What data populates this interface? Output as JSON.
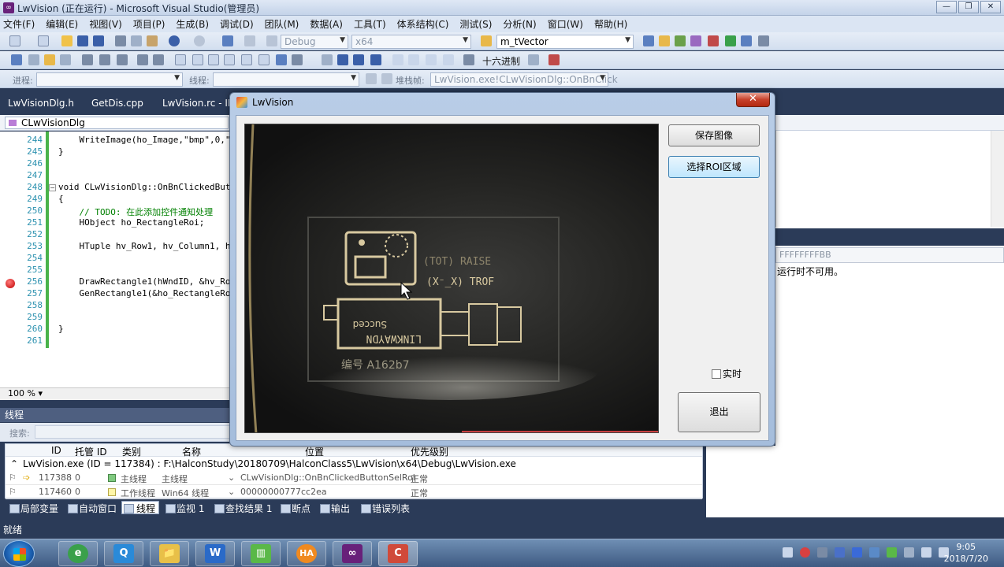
{
  "vs": {
    "title": "LwVision (正在运行) - Microsoft Visual Studio(管理员)",
    "window_controls": [
      "—",
      "❐",
      "✕"
    ],
    "menu": [
      "文件(F)",
      "编辑(E)",
      "视图(V)",
      "项目(P)",
      "生成(B)",
      "调试(D)",
      "团队(M)",
      "数据(A)",
      "工具(T)",
      "体系结构(C)",
      "测试(S)",
      "分析(N)",
      "窗口(W)",
      "帮助(H)"
    ],
    "toolbar": {
      "config": "Debug",
      "platform": "x64",
      "find": "m_tVector",
      "hex_label": "十六进制",
      "process_label": "进程:",
      "thread_label": "线程:",
      "stackframe_label": "堆栈帧:",
      "stackframe_value": "LwVision.exe!CLwVisionDlg::OnBnClick"
    },
    "doc_tabs": [
      "LwVisionDlg.h",
      "GetDis.cpp",
      "LwVision.rc - ID"
    ],
    "nav_class": "CLwVisionDlg",
    "editor": {
      "lines": [
        {
          "n": "244",
          "code": "    WriteImage(ho_Image,\"bmp\",0,\""
        },
        {
          "n": "245",
          "code": "}"
        },
        {
          "n": "246",
          "code": ""
        },
        {
          "n": "247",
          "code": ""
        },
        {
          "n": "248",
          "code": "void CLwVisionDlg::OnBnClickedBut"
        },
        {
          "n": "249",
          "code": "{"
        },
        {
          "n": "250",
          "code": "    // TODO: 在此添加控件通知处理"
        },
        {
          "n": "251",
          "code": "    HObject ho_RectangleRoi;"
        },
        {
          "n": "252",
          "code": ""
        },
        {
          "n": "253",
          "code": "    HTuple hv_Row1, hv_Column1, h"
        },
        {
          "n": "254",
          "code": ""
        },
        {
          "n": "255",
          "code": ""
        },
        {
          "n": "256",
          "code": "    DrawRectangle1(hWndID, &hv_Ro"
        },
        {
          "n": "257",
          "code": "    GenRectangle1(&ho_RectangleRo"
        },
        {
          "n": "258",
          "code": ""
        },
        {
          "n": "259",
          "code": ""
        },
        {
          "n": "260",
          "code": "}"
        },
        {
          "n": "261",
          "code": ""
        }
      ],
      "zoom": "100 %"
    },
    "properties": {
      "combo": "FFFFFFFFBB",
      "message": "运行时不可用。"
    },
    "threads": {
      "title": "线程",
      "search_label": "搜索:",
      "columns": [
        "ID",
        "托管 ID",
        "类别",
        "名称",
        "位置",
        "优先级别"
      ],
      "process": "LwVision.exe (ID = 117384) : F:\\HalconStudy\\20180709\\HalconClass5\\LwVision\\x64\\Debug\\LwVision.exe",
      "rows": [
        {
          "id": "117388",
          "mid": "0",
          "cat": "主线程",
          "name": "主线程",
          "loc": "CLwVisionDlg::OnBnClickedButtonSelRoi",
          "pri": "正常"
        },
        {
          "id": "117460",
          "mid": "0",
          "cat": "工作线程",
          "name": "Win64 线程",
          "loc": "00000000777cc2ea",
          "pri": "正常"
        }
      ]
    },
    "bottom_tabs": [
      "局部变量",
      "自动窗口",
      "线程",
      "监视 1",
      "查找结果 1",
      "断点",
      "输出",
      "错误列表"
    ],
    "status": "就绪"
  },
  "dialog": {
    "title": "LwVision",
    "close": "✕",
    "btn_save": "保存图像",
    "btn_roi": "选择ROI区域",
    "chk_realtime": "实时",
    "btn_exit": "退出",
    "camera_text": {
      "port": "(X⁻_X) TROF",
      "raise": "(TOT) RAISE",
      "brand": "LINKWAYDN",
      "sub": "Succed",
      "serial": "编号 A162b7"
    }
  },
  "taskbar": {
    "apps": [
      "e",
      "Q",
      "📁",
      "W",
      "▥",
      "HA",
      "∞",
      "C"
    ],
    "time": "9:05",
    "date": "2018/7/20"
  }
}
